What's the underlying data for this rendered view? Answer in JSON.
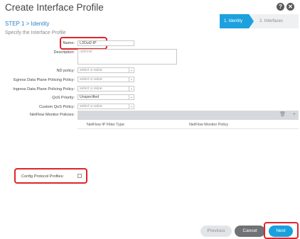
{
  "header": {
    "title": "Create Interface Profile",
    "help_icon": "?",
    "close_icon": "✕"
  },
  "step": "STEP 1 > Identity",
  "wizard": {
    "step1": "1. Identity",
    "step2": "2. Interfaces"
  },
  "subtitle": "Specify the Interface Profile",
  "form": {
    "name_label": "Name:",
    "name_value": "L3Out2-IP",
    "description_label": "Description:",
    "description_placeholder": "optional",
    "nd_policy_label": "ND policy:",
    "nd_policy_value": "select a value",
    "egress_label": "Egress Data Plane Policing Policy:",
    "egress_value": "select a value",
    "ingress_label": "Ingress Data Plane Policing Policy:",
    "ingress_value": "select a value",
    "qos_label": "QoS Priority:",
    "qos_value": "Unspecified",
    "custom_qos_label": "Custom QoS Policy:",
    "custom_qos_value": "select a value",
    "netflow_label": "NetFlow Monitor Policies:",
    "netflow_col1": "NetFlow IP Filter Type",
    "netflow_col2": "NetFlow Monitor Policy",
    "config_protocol_label": "Config Protocol Profiles:"
  },
  "footer": {
    "previous": "Previous",
    "cancel": "Cancel",
    "next": "Next"
  },
  "colors": {
    "accent": "#1da1de",
    "highlight": "#e0242b"
  }
}
